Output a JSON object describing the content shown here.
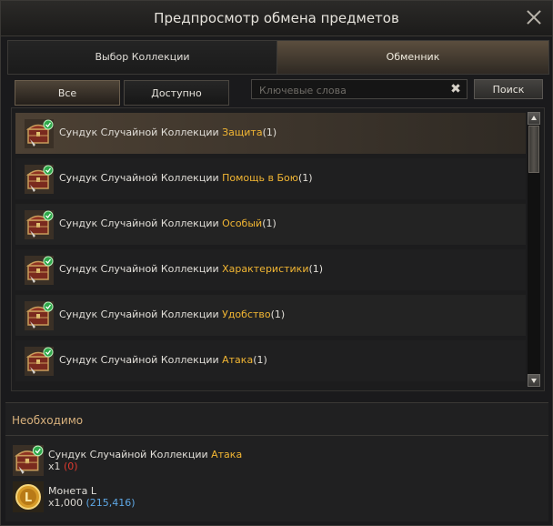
{
  "window": {
    "title": "Предпросмотр обмена предметов"
  },
  "top_tabs": [
    {
      "label": "Выбор Коллекции"
    },
    {
      "label": "Обменник"
    }
  ],
  "filter_tabs": [
    {
      "label": "Все"
    },
    {
      "label": "Доступно"
    }
  ],
  "search": {
    "placeholder": "Ключевые слова",
    "button_label": "Поиск",
    "clear_icon": "close-x-icon"
  },
  "items": [
    {
      "prefix": "Сундук Случайной Коллекции",
      "highlight": "Защита",
      "count": "(1)",
      "icon": "chest-icon"
    },
    {
      "prefix": "Сундук Случайной Коллекции",
      "highlight": "Помощь в Бою",
      "count": "(1)",
      "icon": "chest-icon"
    },
    {
      "prefix": "Сундук Случайной Коллекции",
      "highlight": "Особый",
      "count": "(1)",
      "icon": "chest-icon"
    },
    {
      "prefix": "Сундук Случайной Коллекции",
      "highlight": "Характеристики",
      "count": "(1)",
      "icon": "chest-icon"
    },
    {
      "prefix": "Сундук Случайной Коллекции",
      "highlight": "Удобство",
      "count": "(1)",
      "icon": "chest-icon"
    },
    {
      "prefix": "Сундук Случайной Коллекции",
      "highlight": "Атака",
      "count": "(1)",
      "icon": "chest-icon"
    }
  ],
  "required": {
    "header": "Необходимо",
    "items": [
      {
        "name": "Сундук Случайной Коллекции",
        "name_highlight": "Атака",
        "qty": "x1",
        "owned": "(0)",
        "icon": "chest-icon"
      },
      {
        "name": "Монета L",
        "name_highlight": "",
        "qty": "x1,000",
        "owned": "(215,416)",
        "icon": "coin-l-icon"
      }
    ]
  },
  "colors": {
    "highlight": "#f2b633",
    "insufficient": "#e03a2f",
    "sufficient": "#5ea8e6",
    "header": "#d7b07c"
  }
}
